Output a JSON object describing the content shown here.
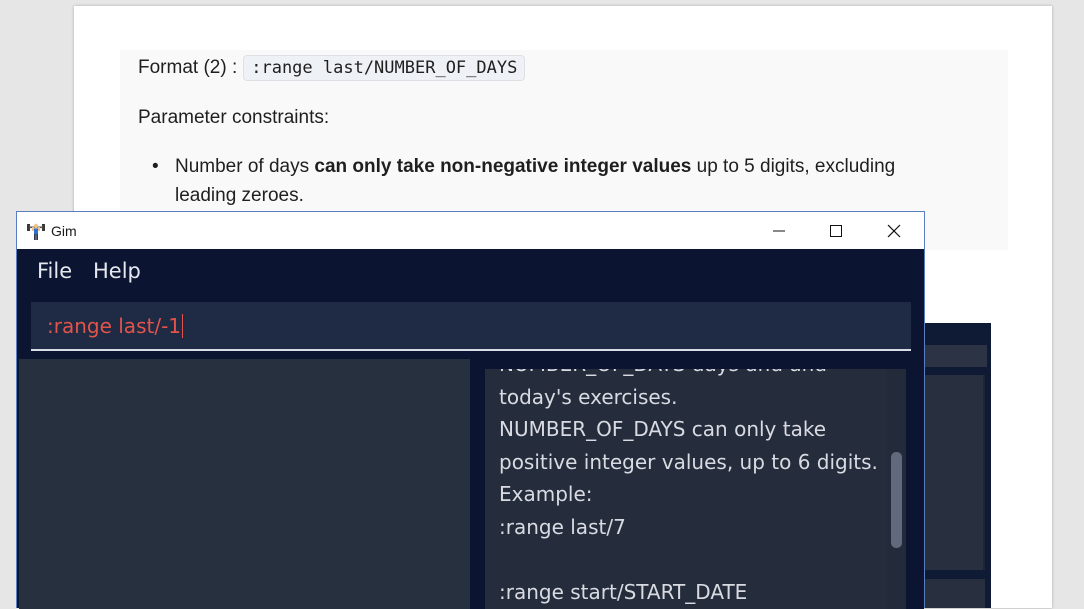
{
  "document": {
    "format_label": "Format (2) :",
    "format_code": ":range last/NUMBER_OF_DAYS",
    "constraints_heading": "Parameter constraints:",
    "bullet_prefix": "Number of days ",
    "bullet_bold": "can only take non-negative integer values",
    "bullet_suffix": " up to 5 digits, excluding leading zeroes."
  },
  "window": {
    "title": "Gim",
    "controls": [
      "minimize-icon",
      "maximize-icon",
      "close-icon"
    ]
  },
  "menu": {
    "file": "File",
    "help": "Help"
  },
  "command": {
    "value": ":range last/-1",
    "text_color": "#e2544a"
  },
  "result": {
    "lines": [
      "NUMBER_OF_DAYS days and and",
      "today's exercises.",
      "NUMBER_OF_DAYS can only take",
      "positive integer values, up to 6 digits.",
      "Example:",
      ":range last/7",
      "",
      ":range start/START_DATE"
    ]
  },
  "colors": {
    "window_bg": "#0b1430",
    "panel_bg": "#27303f",
    "error_text": "#e2544a"
  }
}
